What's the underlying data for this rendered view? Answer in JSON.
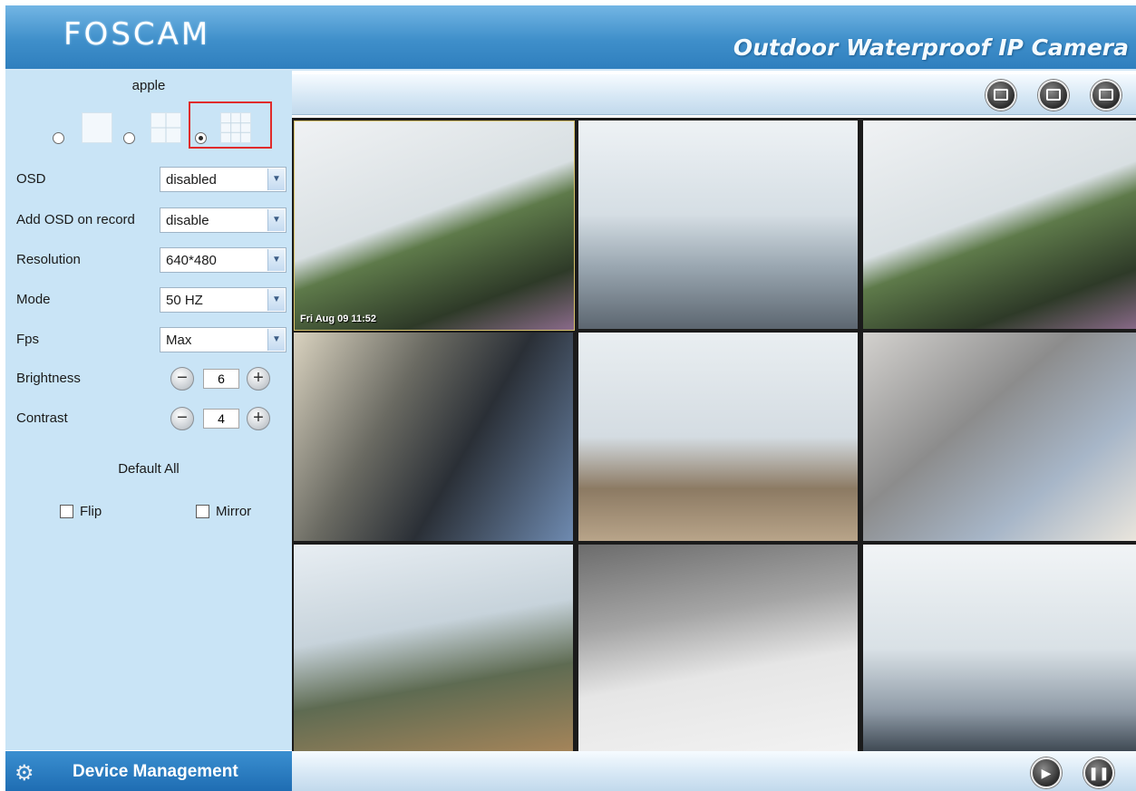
{
  "header": {
    "logo": "FOSCAM",
    "tagline": "Outdoor Waterproof IP Camera"
  },
  "sidebar": {
    "camera_name": "apple",
    "layout_options": [
      {
        "name": "1 view",
        "selected": false
      },
      {
        "name": "4 views",
        "selected": false
      },
      {
        "name": "9 views",
        "selected": true
      }
    ],
    "settings": [
      {
        "label": "OSD",
        "value": "disabled"
      },
      {
        "label": "Add OSD on record",
        "value": "disable"
      },
      {
        "label": "Resolution",
        "value": "640*480"
      },
      {
        "label": "Mode",
        "value": "50 HZ"
      },
      {
        "label": "Fps",
        "value": "Max"
      }
    ],
    "brightness": {
      "label": "Brightness",
      "value": "6"
    },
    "contrast": {
      "label": "Contrast",
      "value": "4"
    },
    "default_all": "Default All",
    "flip": {
      "label": "Flip",
      "checked": false
    },
    "mirror": {
      "label": "Mirror",
      "checked": false
    }
  },
  "video": {
    "cell_1_overlay": "Fri Aug 09 11:52"
  },
  "footer": {
    "device_management": "Device Management"
  },
  "colors": {
    "header_blue": "#3f8fca",
    "sidebar_bg": "#c9e4f6",
    "highlight_red": "#e02b2b"
  }
}
